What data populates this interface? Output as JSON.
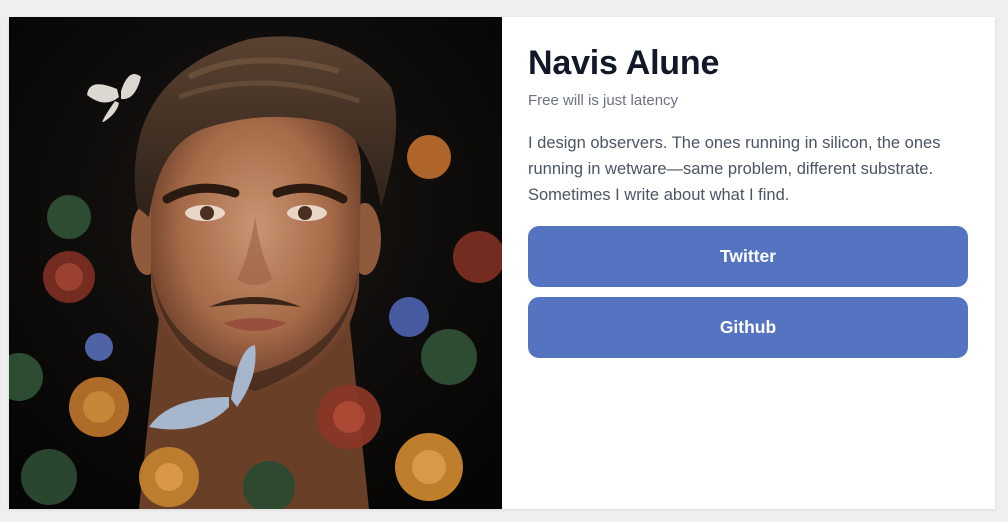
{
  "profile": {
    "name": "Navis Alune",
    "tagline": "Free will is just latency",
    "bio": "I design observers. The ones running in silicon, the ones running in wetware—same problem, different substrate. Sometimes I write about what I find."
  },
  "links": [
    {
      "label": "Twitter"
    },
    {
      "label": "Github"
    }
  ],
  "colors": {
    "page_background": "#efefef",
    "card_background": "#ffffff",
    "button": "#5474c2",
    "button_text": "#ffffff",
    "name": "#111827",
    "tagline": "#6b7280",
    "bio": "#4b5563"
  }
}
